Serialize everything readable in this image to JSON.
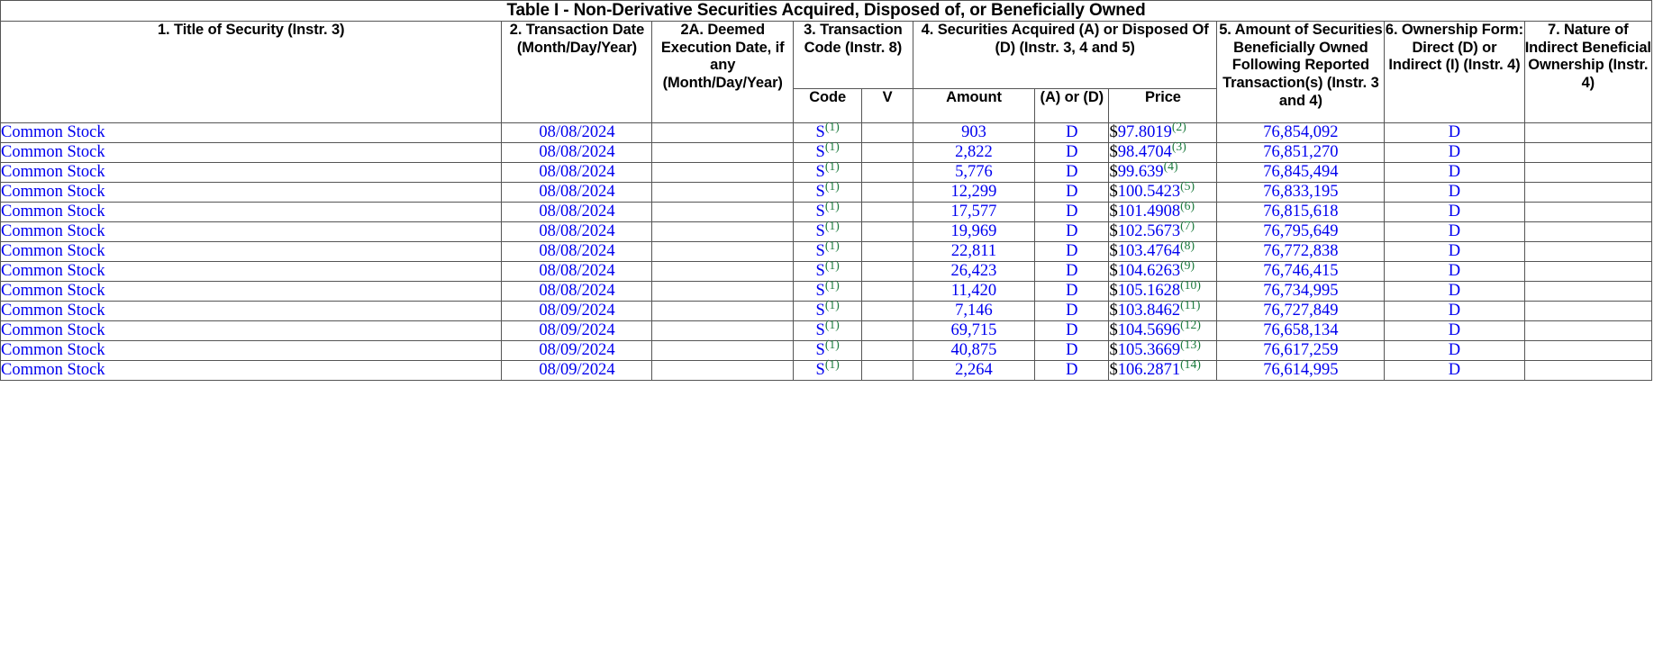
{
  "table": {
    "caption": "Table I - Non-Derivative Securities Acquired, Disposed of, or Beneficially Owned",
    "headers": {
      "col1": "1. Title of Security (Instr. 3)",
      "col2": "2. Transaction Date (Month/Day/Year)",
      "col2a": "2A. Deemed Execution Date, if any (Month/Day/Year)",
      "col3": "3. Transaction Code (Instr. 8)",
      "col4": "4. Securities Acquired (A) or Disposed Of (D) (Instr. 3, 4 and 5)",
      "col5": "5. Amount of Securities Beneficially Owned Following Reported Transaction(s) (Instr. 3 and 4)",
      "col6": "6. Ownership Form: Direct (D) or Indirect (I) (Instr. 4)",
      "col7": "7. Nature of Indirect Beneficial Ownership (Instr. 4)"
    },
    "subheaders": {
      "code": "Code",
      "v": "V",
      "amount": "Amount",
      "ad": "(A) or (D)",
      "price": "Price"
    },
    "rows": [
      {
        "security": "Common Stock",
        "transaction_date": "08/08/2024",
        "deemed_execution_date": "",
        "code": "S",
        "code_footnote": "(1)",
        "v": "",
        "amount": "903",
        "acquired_disposed": "D",
        "price_symbol": "$",
        "price": "97.8019",
        "price_footnote": "(2)",
        "shares_owned_after": "76,854,092",
        "ownership_form": "D",
        "nature_indirect": ""
      },
      {
        "security": "Common Stock",
        "transaction_date": "08/08/2024",
        "deemed_execution_date": "",
        "code": "S",
        "code_footnote": "(1)",
        "v": "",
        "amount": "2,822",
        "acquired_disposed": "D",
        "price_symbol": "$",
        "price": "98.4704",
        "price_footnote": "(3)",
        "shares_owned_after": "76,851,270",
        "ownership_form": "D",
        "nature_indirect": ""
      },
      {
        "security": "Common Stock",
        "transaction_date": "08/08/2024",
        "deemed_execution_date": "",
        "code": "S",
        "code_footnote": "(1)",
        "v": "",
        "amount": "5,776",
        "acquired_disposed": "D",
        "price_symbol": "$",
        "price": "99.639",
        "price_footnote": "(4)",
        "shares_owned_after": "76,845,494",
        "ownership_form": "D",
        "nature_indirect": ""
      },
      {
        "security": "Common Stock",
        "transaction_date": "08/08/2024",
        "deemed_execution_date": "",
        "code": "S",
        "code_footnote": "(1)",
        "v": "",
        "amount": "12,299",
        "acquired_disposed": "D",
        "price_symbol": "$",
        "price": "100.5423",
        "price_footnote": "(5)",
        "shares_owned_after": "76,833,195",
        "ownership_form": "D",
        "nature_indirect": ""
      },
      {
        "security": "Common Stock",
        "transaction_date": "08/08/2024",
        "deemed_execution_date": "",
        "code": "S",
        "code_footnote": "(1)",
        "v": "",
        "amount": "17,577",
        "acquired_disposed": "D",
        "price_symbol": "$",
        "price": "101.4908",
        "price_footnote": "(6)",
        "shares_owned_after": "76,815,618",
        "ownership_form": "D",
        "nature_indirect": ""
      },
      {
        "security": "Common Stock",
        "transaction_date": "08/08/2024",
        "deemed_execution_date": "",
        "code": "S",
        "code_footnote": "(1)",
        "v": "",
        "amount": "19,969",
        "acquired_disposed": "D",
        "price_symbol": "$",
        "price": "102.5673",
        "price_footnote": "(7)",
        "shares_owned_after": "76,795,649",
        "ownership_form": "D",
        "nature_indirect": ""
      },
      {
        "security": "Common Stock",
        "transaction_date": "08/08/2024",
        "deemed_execution_date": "",
        "code": "S",
        "code_footnote": "(1)",
        "v": "",
        "amount": "22,811",
        "acquired_disposed": "D",
        "price_symbol": "$",
        "price": "103.4764",
        "price_footnote": "(8)",
        "shares_owned_after": "76,772,838",
        "ownership_form": "D",
        "nature_indirect": ""
      },
      {
        "security": "Common Stock",
        "transaction_date": "08/08/2024",
        "deemed_execution_date": "",
        "code": "S",
        "code_footnote": "(1)",
        "v": "",
        "amount": "26,423",
        "acquired_disposed": "D",
        "price_symbol": "$",
        "price": "104.6263",
        "price_footnote": "(9)",
        "shares_owned_after": "76,746,415",
        "ownership_form": "D",
        "nature_indirect": ""
      },
      {
        "security": "Common Stock",
        "transaction_date": "08/08/2024",
        "deemed_execution_date": "",
        "code": "S",
        "code_footnote": "(1)",
        "v": "",
        "amount": "11,420",
        "acquired_disposed": "D",
        "price_symbol": "$",
        "price": "105.1628",
        "price_footnote": "(10)",
        "shares_owned_after": "76,734,995",
        "ownership_form": "D",
        "nature_indirect": ""
      },
      {
        "security": "Common Stock",
        "transaction_date": "08/09/2024",
        "deemed_execution_date": "",
        "code": "S",
        "code_footnote": "(1)",
        "v": "",
        "amount": "7,146",
        "acquired_disposed": "D",
        "price_symbol": "$",
        "price": "103.8462",
        "price_footnote": "(11)",
        "shares_owned_after": "76,727,849",
        "ownership_form": "D",
        "nature_indirect": ""
      },
      {
        "security": "Common Stock",
        "transaction_date": "08/09/2024",
        "deemed_execution_date": "",
        "code": "S",
        "code_footnote": "(1)",
        "v": "",
        "amount": "69,715",
        "acquired_disposed": "D",
        "price_symbol": "$",
        "price": "104.5696",
        "price_footnote": "(12)",
        "shares_owned_after": "76,658,134",
        "ownership_form": "D",
        "nature_indirect": ""
      },
      {
        "security": "Common Stock",
        "transaction_date": "08/09/2024",
        "deemed_execution_date": "",
        "code": "S",
        "code_footnote": "(1)",
        "v": "",
        "amount": "40,875",
        "acquired_disposed": "D",
        "price_symbol": "$",
        "price": "105.3669",
        "price_footnote": "(13)",
        "shares_owned_after": "76,617,259",
        "ownership_form": "D",
        "nature_indirect": ""
      },
      {
        "security": "Common Stock",
        "transaction_date": "08/09/2024",
        "deemed_execution_date": "",
        "code": "S",
        "code_footnote": "(1)",
        "v": "",
        "amount": "2,264",
        "acquired_disposed": "D",
        "price_symbol": "$",
        "price": "106.2871",
        "price_footnote": "(14)",
        "shares_owned_after": "76,614,995",
        "ownership_form": "D",
        "nature_indirect": ""
      }
    ]
  },
  "colors": {
    "link": "#0000ee",
    "footnote": "#1a7a3c",
    "text": "#000000",
    "border": "#555555"
  }
}
